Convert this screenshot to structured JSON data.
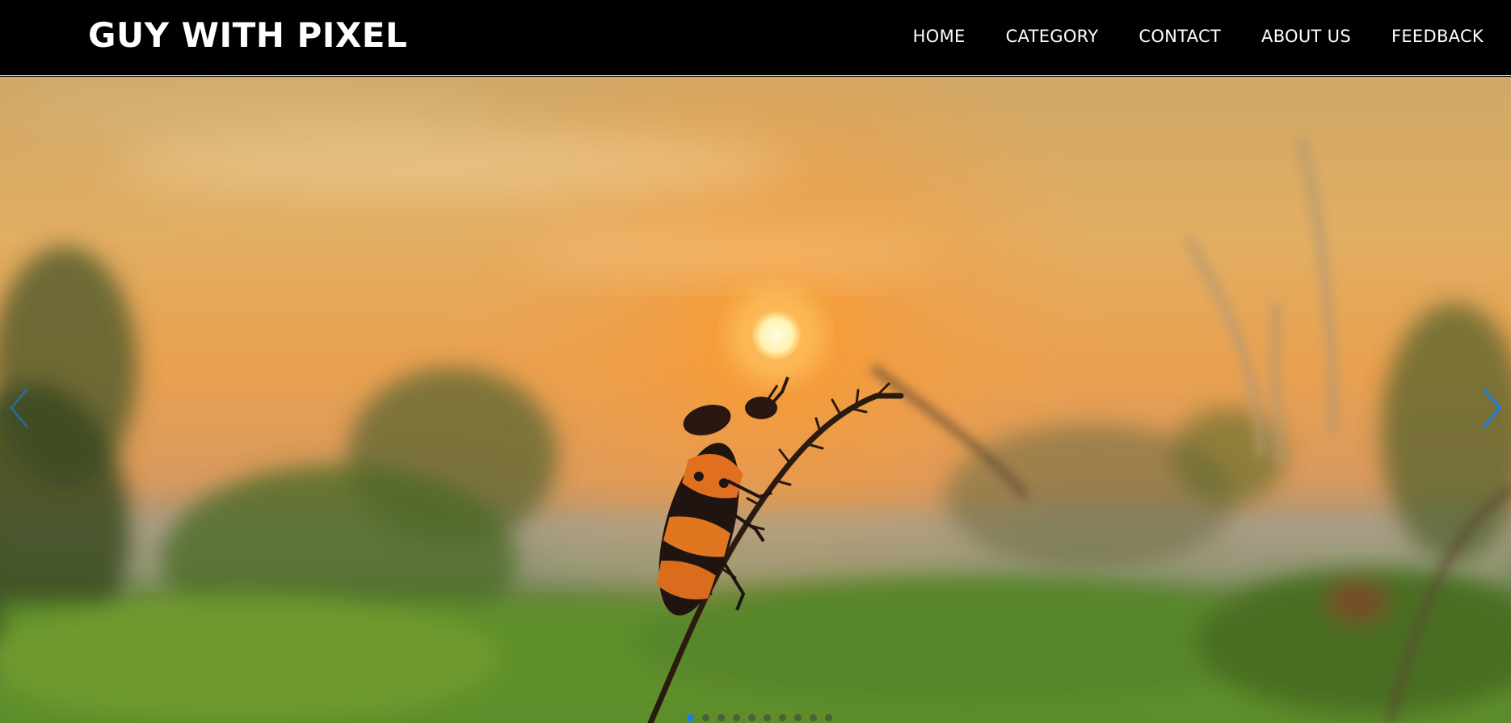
{
  "brand": {
    "title": "GUY WITH PIXEL"
  },
  "nav": {
    "items": [
      {
        "label": "HOME"
      },
      {
        "label": "CATEGORY"
      },
      {
        "label": "CONTACT"
      },
      {
        "label": "ABOUT US"
      },
      {
        "label": "FEEDBACK"
      }
    ]
  },
  "carousel": {
    "slide_description_icon": "sunset-beetle-photo",
    "prev_icon": "chevron-left-icon",
    "next_icon": "chevron-right-icon",
    "arrow_color": "#1b7bea",
    "active_indicator_color": "#1b7bea",
    "indicator_count": 10,
    "active_index": 0
  },
  "colors": {
    "navbar_bg": "#000000",
    "nav_text": "#ffffff"
  }
}
